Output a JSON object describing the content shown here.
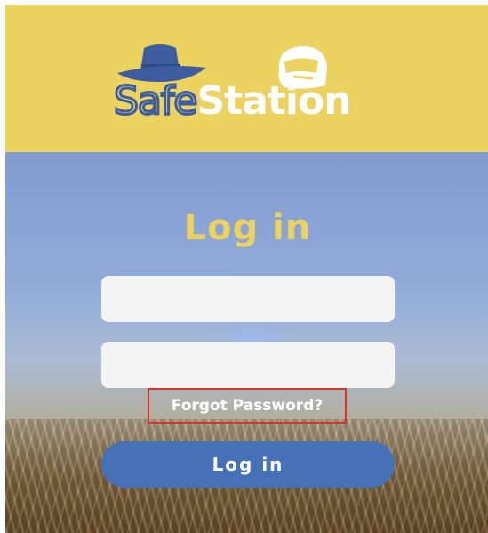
{
  "brand": {
    "name_part1": "Safe",
    "name_part2": "Station",
    "header_color": "#ecd25e",
    "primary_color": "#4671b7"
  },
  "icons": {
    "hat": "cowboy-hat-icon",
    "helmet": "motorcycle-helmet-icon"
  },
  "login": {
    "title": "Log in",
    "username_value": "",
    "password_value": "",
    "forgot_label": "Forgot Password?",
    "submit_label": "Log in",
    "highlight_color": "#d9342b"
  }
}
